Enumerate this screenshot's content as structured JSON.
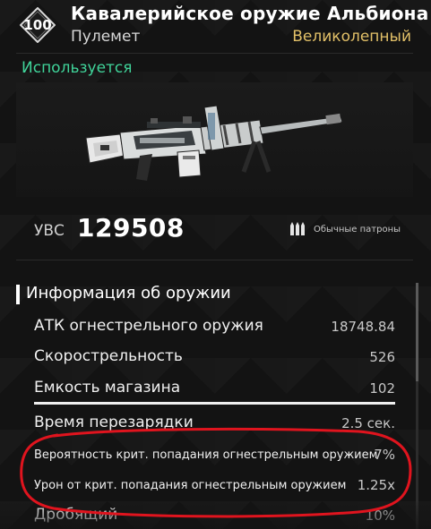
{
  "header": {
    "level": "100",
    "weapon_name": "Кавалерийское оружие Альбиона",
    "weapon_type": "Пулемет",
    "rarity": "Великолепный",
    "rarity_color": "#e2c068",
    "status": "Используется",
    "status_color": "#40d49a"
  },
  "power": {
    "label": "УВС",
    "value": "129508",
    "ammo_icon": "bullets-icon",
    "ammo_label": "Обычные патроны"
  },
  "info": {
    "title": "Информация об оружии",
    "scroll_position": 0.0,
    "stats": [
      {
        "name": "АТК огнестрельного оружия",
        "value": "18748.84"
      },
      {
        "name": "Скорострельность",
        "value": "526"
      },
      {
        "name": "Емкость магазина",
        "value": "102"
      },
      {
        "name": "Время перезарядки",
        "value": "2.5 сек."
      },
      {
        "name": "Вероятность крит. попадания огнестрельным оружием",
        "value": "7%"
      },
      {
        "name": "Урон от крит. попадания огнестрельным оружием",
        "value": "1.25x"
      },
      {
        "name": "Дробящий",
        "value": "10%"
      }
    ]
  },
  "annotation": {
    "type": "red-hand-drawn-ellipse",
    "color": "#e0141e"
  }
}
